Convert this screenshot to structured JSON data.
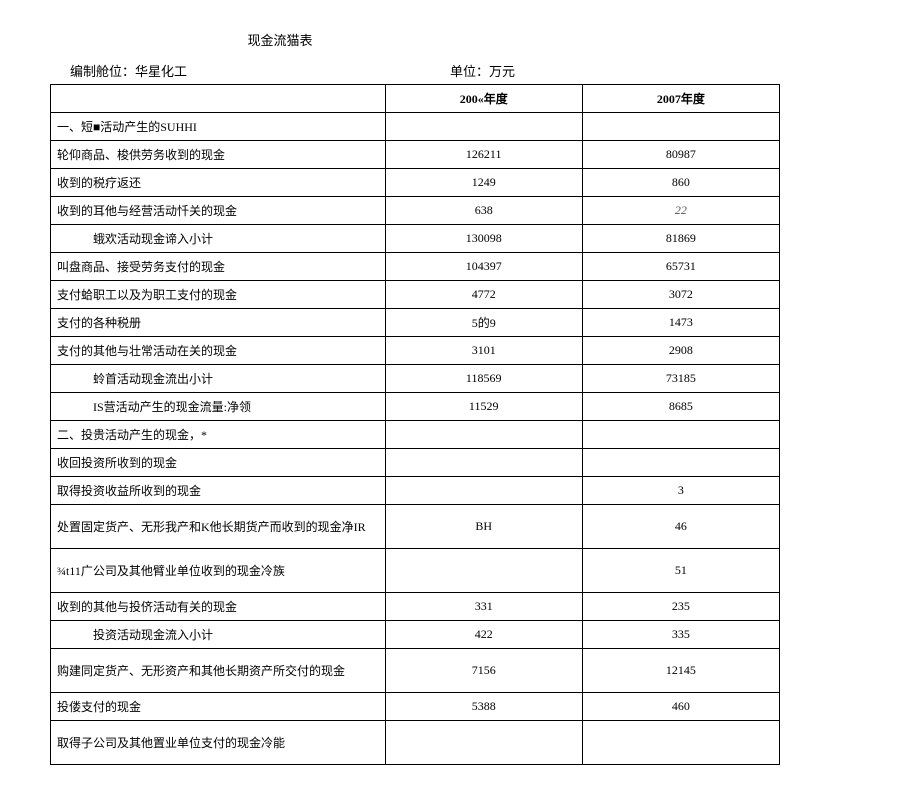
{
  "title": "现金流猫表",
  "header": {
    "unit_label": "编制舱位：华星化工",
    "currency_label": "单位：万元"
  },
  "columns": {
    "label": "",
    "y1": "200«年度",
    "y2": "2007年度"
  },
  "rows": [
    {
      "label": "一、短■活动产生的SUHHI",
      "v1": "",
      "v2": ""
    },
    {
      "label": "轮仰商品、梭供劳务收到的现金",
      "v1": "126211",
      "v2": "80987"
    },
    {
      "label": "收到的税疗返还",
      "v1": "1249",
      "v2": "860"
    },
    {
      "label": "收到的耳他与经营活动忏关的现金",
      "v1": "638",
      "v2": "22",
      "v2_italic": true
    },
    {
      "label": "蛾欢活动现金谛入小计",
      "indent": true,
      "v1": "130098",
      "v2": "81869"
    },
    {
      "label": "叫盘商品、接受劳务支付的现金",
      "v1": "104397",
      "v2": "65731"
    },
    {
      "label": "支付蛤职工以及为职工支付的现金",
      "v1": "4772",
      "v2": "3072"
    },
    {
      "label": "支付的各种税册",
      "v1": "5的9",
      "v2": "1473"
    },
    {
      "label": "支付的其他与壮常活动在关的现金",
      "v1": "3101",
      "v2": "2908"
    },
    {
      "label": "蛉首活动现金流出小计",
      "indent": true,
      "v1": "118569",
      "v2": "73185"
    },
    {
      "label": "IS营活动产生的现金流量:净领",
      "indent": true,
      "v1": "11529",
      "v2": "8685"
    },
    {
      "label": "二、投贵活动产生的现金，*",
      "v1": "",
      "v2": ""
    },
    {
      "label": "收回投资所收到的现金",
      "v1": "",
      "v2": ""
    },
    {
      "label": "取得投资收益所收到的现金",
      "v1": "",
      "v2": "3"
    },
    {
      "label": "处置固定货产、无形我产和K他长期货产而收到的现金净IR",
      "double": true,
      "v1": "BH",
      "v2": "46"
    },
    {
      "label": "¾t11广公司及其他臂业单位收到的现金冷族",
      "double": true,
      "v1": "",
      "v2": "51"
    },
    {
      "label": "收到的其他与投侪活动有关的现金",
      "v1": "331",
      "v2": "235"
    },
    {
      "label": "投资活动现金流入小计",
      "indent": true,
      "v1": "422",
      "v2": "335"
    },
    {
      "label": "购建同定货产、无形资产和其他长期资产所交付的现金",
      "double": true,
      "v1": "7156",
      "v2": "12145"
    },
    {
      "label": "投偻支付的现金",
      "v1": "5388",
      "v2": "460"
    },
    {
      "label": "取得子公司及其他置业单位支付的现金冷能",
      "double": true,
      "v1": "",
      "v2": ""
    }
  ]
}
